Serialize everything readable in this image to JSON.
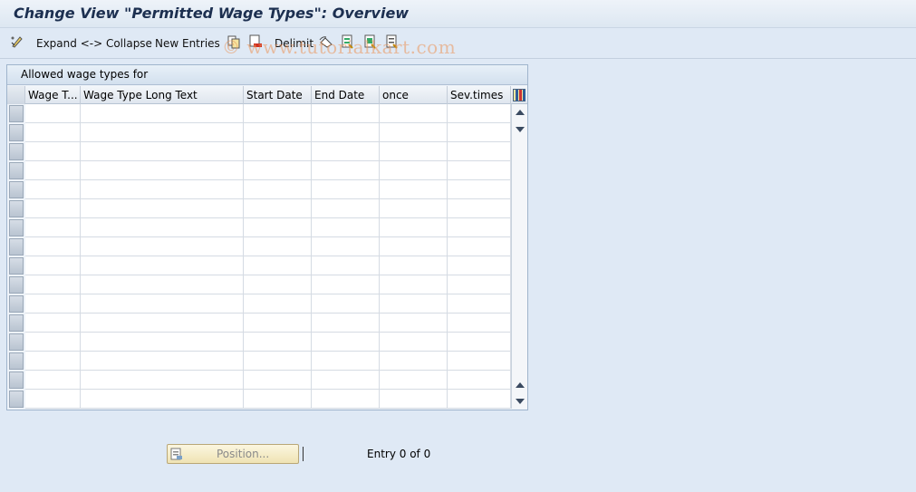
{
  "window": {
    "title": "Change View \"Permitted Wage Types\": Overview"
  },
  "toolbar": {
    "expand_collapse": "Expand <-> Collapse",
    "new_entries": "New Entries",
    "delimit": "Delimit"
  },
  "watermark": "© www.tutorialkart.com",
  "table": {
    "caption": "Allowed wage types for",
    "columns": [
      "Wage T...",
      "Wage Type Long Text",
      "Start Date",
      "End Date",
      "once",
      "Sev.times"
    ],
    "row_count": 16
  },
  "footer": {
    "position_button": "Position...",
    "entry_status": "Entry 0 of 0"
  },
  "colors": {
    "background": "#dfe9f5",
    "title": "#1c2f50",
    "watermark": "#eb965a"
  }
}
